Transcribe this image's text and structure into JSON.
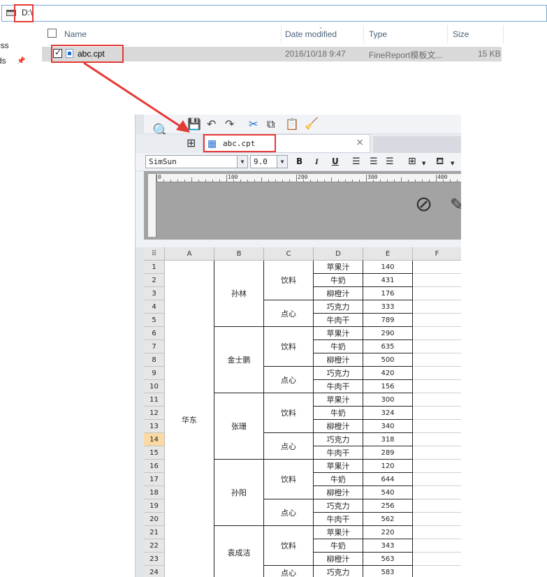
{
  "explorer": {
    "address": "D:\\",
    "nav_items": [
      "ess",
      "ds"
    ],
    "columns": {
      "name": "Name",
      "date_modified": "Date modified",
      "type": "Type",
      "size": "Size"
    },
    "file": {
      "name": "abc.cpt",
      "date": "2016/10/18 9:47",
      "type": "FineReport模板文...",
      "size": "15 KB",
      "checked": true
    }
  },
  "designer": {
    "tab_label": "abc.cpt",
    "tab_close": "×",
    "font_name": "SimSun",
    "font_size": "9.0",
    "bold": "B",
    "italic": "I",
    "underline": "U",
    "ruler_marks": [
      "0",
      "100",
      "200",
      "300",
      "400"
    ],
    "col_headers": [
      "A",
      "B",
      "C",
      "D",
      "E",
      "F"
    ],
    "selected_row": 14,
    "region": "华东",
    "people": [
      {
        "name": "孙林",
        "rows": [
          [
            "饮料",
            "苹果汁",
            140
          ],
          [
            "饮料",
            "牛奶",
            431
          ],
          [
            "饮料",
            "柳橙汁",
            176
          ],
          [
            "点心",
            "巧克力",
            333
          ],
          [
            "点心",
            "牛肉干",
            789
          ]
        ]
      },
      {
        "name": "金士鹏",
        "rows": [
          [
            "饮料",
            "苹果汁",
            290
          ],
          [
            "饮料",
            "牛奶",
            635
          ],
          [
            "饮料",
            "柳橙汁",
            500
          ],
          [
            "点心",
            "巧克力",
            420
          ],
          [
            "点心",
            "牛肉干",
            156
          ]
        ]
      },
      {
        "name": "张珊",
        "rows": [
          [
            "饮料",
            "苹果汁",
            300
          ],
          [
            "饮料",
            "牛奶",
            324
          ],
          [
            "饮料",
            "柳橙汁",
            340
          ],
          [
            "点心",
            "巧克力",
            318
          ],
          [
            "点心",
            "牛肉干",
            289
          ]
        ]
      },
      {
        "name": "孙阳",
        "rows": [
          [
            "饮料",
            "苹果汁",
            120
          ],
          [
            "饮料",
            "牛奶",
            644
          ],
          [
            "饮料",
            "柳橙汁",
            540
          ],
          [
            "点心",
            "巧克力",
            256
          ],
          [
            "点心",
            "牛肉干",
            562
          ]
        ]
      },
      {
        "name": "袁成洁",
        "rows": [
          [
            "饮料",
            "苹果汁",
            220
          ],
          [
            "饮料",
            "牛奶",
            343
          ],
          [
            "饮料",
            "柳橙汁",
            563
          ],
          [
            "点心",
            "巧克力",
            583
          ]
        ]
      }
    ],
    "cut_category_label": "点心"
  },
  "colors": {
    "highlight": "#e53935",
    "selected_row": "#fbd9a3",
    "accent": "#1f6fd1"
  }
}
